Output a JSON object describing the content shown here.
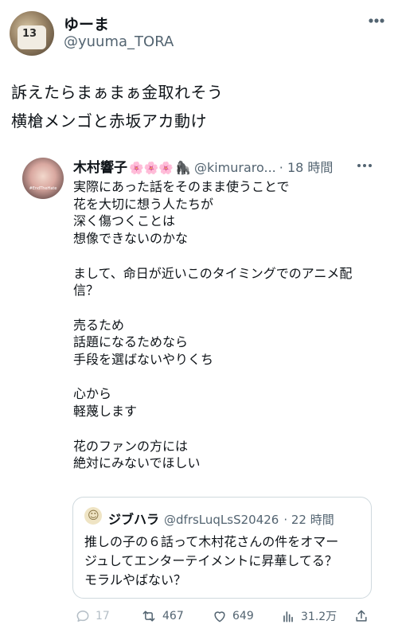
{
  "author": {
    "name": "ゆーま",
    "handle": "@yuuma_TORA",
    "avatar_jersey_number": "13"
  },
  "post": {
    "lines": [
      "訴えたらまぁまぁ金取れそう",
      "横槍メンゴと赤坂アカ動け"
    ]
  },
  "quote": {
    "name": "木村響子",
    "emoji": "🌸🌸🌸",
    "gorilla": "🦍",
    "handle": "@kimuraro...",
    "time": "· 18 時間",
    "avatar_caption": "#EndTheHate",
    "text": "実際にあった話をそのまま使うことで\n花を大切に想う人たちが\n深く傷つくことは\n想像できないのかな\n\nまして、命日が近いこのタイミングでのアニメ配\n信？\n\n売るため\n話題になるためなら\n手段を選ばないやりくち\n\n心から\n軽蔑します\n\n花のファンの方には\n絶対にみないでほしい"
  },
  "nested_quote": {
    "name": "ジブハラ",
    "handle": "@dfrsLuqLsS20426",
    "time": "· 22 時間",
    "text": "推しの子の６話って木村花さんの件をオマー\nジュしてエンターテイメントに昇華してる？\nモラルやばない？"
  },
  "actions": {
    "reply_count": "17",
    "retweet_count": "467",
    "like_count": "649",
    "views_count": "31.2万"
  },
  "icons": [
    "more-icon",
    "reply-icon",
    "retweet-icon",
    "like-icon",
    "views-icon",
    "share-icon"
  ]
}
